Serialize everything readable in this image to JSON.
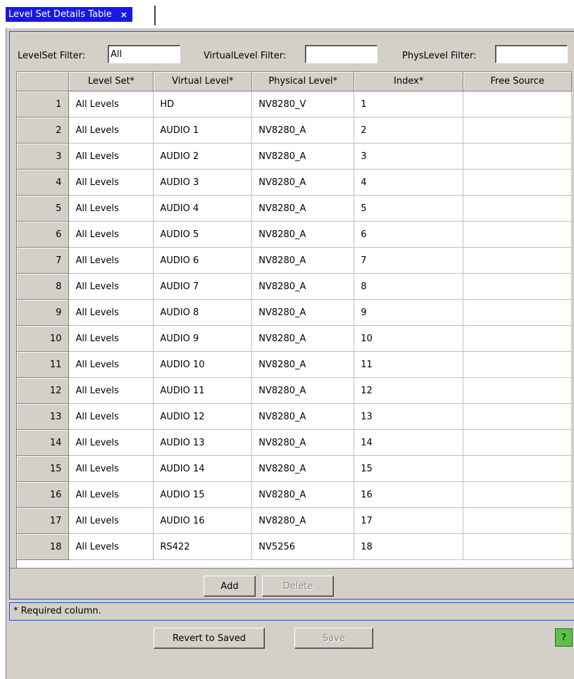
{
  "tab": {
    "title": "Level Set Details Table",
    "close": "×"
  },
  "filters": {
    "levelset_label": "LevelSet Filter:",
    "levelset_value": "All",
    "virtual_label": "VirtualLevel Filter:",
    "virtual_value": "",
    "phys_label": "PhysLevel Filter:",
    "phys_value": ""
  },
  "table": {
    "columns": [
      "Level Set*",
      "Virtual Level*",
      "Physical Level*",
      "Index*",
      "Free Source"
    ],
    "rows": [
      {
        "n": "1",
        "level_set": "All Levels",
        "virtual": "HD",
        "physical": "NV8280_V",
        "index": "1",
        "free": ""
      },
      {
        "n": "2",
        "level_set": "All Levels",
        "virtual": "AUDIO 1",
        "physical": "NV8280_A",
        "index": "2",
        "free": ""
      },
      {
        "n": "3",
        "level_set": "All Levels",
        "virtual": "AUDIO 2",
        "physical": "NV8280_A",
        "index": "3",
        "free": ""
      },
      {
        "n": "4",
        "level_set": "All Levels",
        "virtual": "AUDIO 3",
        "physical": "NV8280_A",
        "index": "4",
        "free": ""
      },
      {
        "n": "5",
        "level_set": "All Levels",
        "virtual": "AUDIO 4",
        "physical": "NV8280_A",
        "index": "5",
        "free": ""
      },
      {
        "n": "6",
        "level_set": "All Levels",
        "virtual": "AUDIO 5",
        "physical": "NV8280_A",
        "index": "6",
        "free": ""
      },
      {
        "n": "7",
        "level_set": "All Levels",
        "virtual": "AUDIO 6",
        "physical": "NV8280_A",
        "index": "7",
        "free": ""
      },
      {
        "n": "8",
        "level_set": "All Levels",
        "virtual": "AUDIO 7",
        "physical": "NV8280_A",
        "index": "8",
        "free": ""
      },
      {
        "n": "9",
        "level_set": "All Levels",
        "virtual": "AUDIO 8",
        "physical": "NV8280_A",
        "index": "9",
        "free": ""
      },
      {
        "n": "10",
        "level_set": "All Levels",
        "virtual": "AUDIO 9",
        "physical": "NV8280_A",
        "index": "10",
        "free": ""
      },
      {
        "n": "11",
        "level_set": "All Levels",
        "virtual": "AUDIO 10",
        "physical": "NV8280_A",
        "index": "11",
        "free": ""
      },
      {
        "n": "12",
        "level_set": "All Levels",
        "virtual": "AUDIO 11",
        "physical": "NV8280_A",
        "index": "12",
        "free": ""
      },
      {
        "n": "13",
        "level_set": "All Levels",
        "virtual": "AUDIO 12",
        "physical": "NV8280_A",
        "index": "13",
        "free": ""
      },
      {
        "n": "14",
        "level_set": "All Levels",
        "virtual": "AUDIO 13",
        "physical": "NV8280_A",
        "index": "14",
        "free": ""
      },
      {
        "n": "15",
        "level_set": "All Levels",
        "virtual": "AUDIO 14",
        "physical": "NV8280_A",
        "index": "15",
        "free": ""
      },
      {
        "n": "16",
        "level_set": "All Levels",
        "virtual": "AUDIO 15",
        "physical": "NV8280_A",
        "index": "16",
        "free": ""
      },
      {
        "n": "17",
        "level_set": "All Levels",
        "virtual": "AUDIO 16",
        "physical": "NV8280_A",
        "index": "17",
        "free": ""
      },
      {
        "n": "18",
        "level_set": "All Levels",
        "virtual": "RS422",
        "physical": "NV5256",
        "index": "18",
        "free": ""
      }
    ]
  },
  "buttons": {
    "add": "Add",
    "delete": "Delete",
    "revert": "Revert to Saved",
    "save": "Save",
    "help": "?"
  },
  "footer": {
    "required_note": "* Required column."
  },
  "colors": {
    "tab_bg": "#1818e6",
    "panel_bg": "#d4d0c8",
    "frame_border": "#2b4bd9",
    "help_bg": "#5fbf4a"
  }
}
